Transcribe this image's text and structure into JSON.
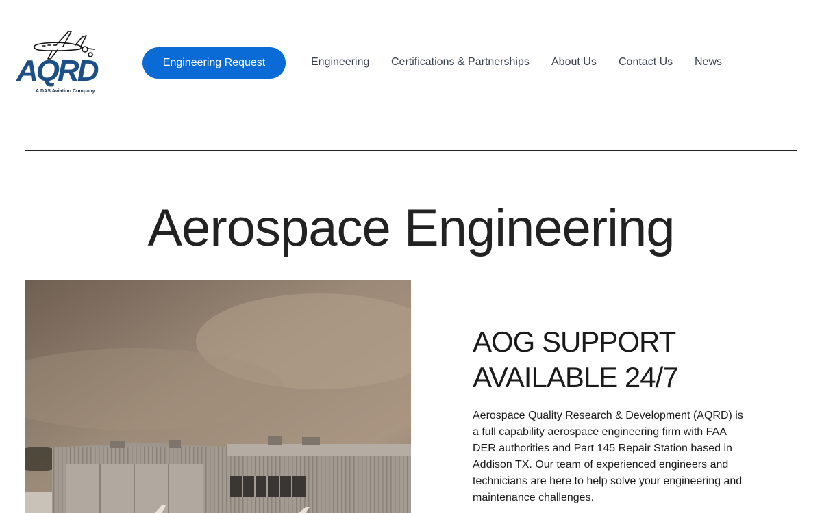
{
  "header": {
    "logo_text": "AQRD",
    "logo_subtitle": "A DAS Aviation Company",
    "cta_label": "Engineering Request",
    "nav": [
      "Engineering",
      "Certifications & Partnerships",
      "About Us",
      "Contact Us",
      "News"
    ]
  },
  "hero": {
    "title": "Aerospace Engineering"
  },
  "section": {
    "heading_line1": "AOG SUPPORT",
    "heading_line2": "AVAILABLE 24/7",
    "body": "Aerospace Quality Research & Development (AQRD) is a full capability aerospace engineering firm with FAA DER authorities and Part 145 Repair Station based in Addison TX. Our team of experienced engineers and technicians are here to help solve your engineering and maintenance challenges."
  },
  "colors": {
    "brand_blue": "#1b4f86",
    "cta_blue": "#0a6ad6",
    "text": "#222222",
    "nav_text": "#3a4250"
  },
  "icons": {
    "logo_graphic": "airplane-icon",
    "photo": "hangar-photo"
  }
}
